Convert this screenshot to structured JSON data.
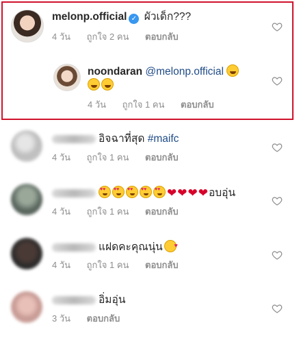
{
  "comments": [
    {
      "username": "melonp.official",
      "verified": true,
      "text": "ผัวเด็ก???",
      "time": "4 วัน",
      "likes": "ถูกใจ 2 คน",
      "reply": "ตอบกลับ"
    },
    {
      "username": "noondaran",
      "mention": "@melonp.official",
      "time": "4 วัน",
      "likes": "ถูกใจ 1 คน",
      "reply": "ตอบกลับ"
    },
    {
      "username": "chaiheet",
      "text": "อิจฉาที่สุด",
      "hashtag": "#maifc",
      "time": "4 วัน",
      "likes": "ถูกใจ 1 คน",
      "reply": "ตอบกลับ"
    },
    {
      "username": "allseet",
      "text": "อบอุ่น",
      "time": "4 วัน",
      "likes": "ถูกใจ 1 คน",
      "reply": "ตอบกลับ"
    },
    {
      "username": "amonkorngage",
      "text": "แฝดคะคุณนุ่น",
      "time": "4 วัน",
      "likes": "ถูกใจ 1 คน",
      "reply": "ตอบกลับ"
    },
    {
      "username": "lawandsonna",
      "text": "อิ่มอุ่น",
      "time": "3 วัน",
      "reply": "ตอบกลับ"
    }
  ],
  "icons": {
    "like": "heart-outline-icon",
    "verified": "verified-badge-icon"
  },
  "colors": {
    "highlight_border": "#d0112b",
    "link": "#1f4b86",
    "meta": "#8e8e8e",
    "verified": "#3897f0"
  }
}
